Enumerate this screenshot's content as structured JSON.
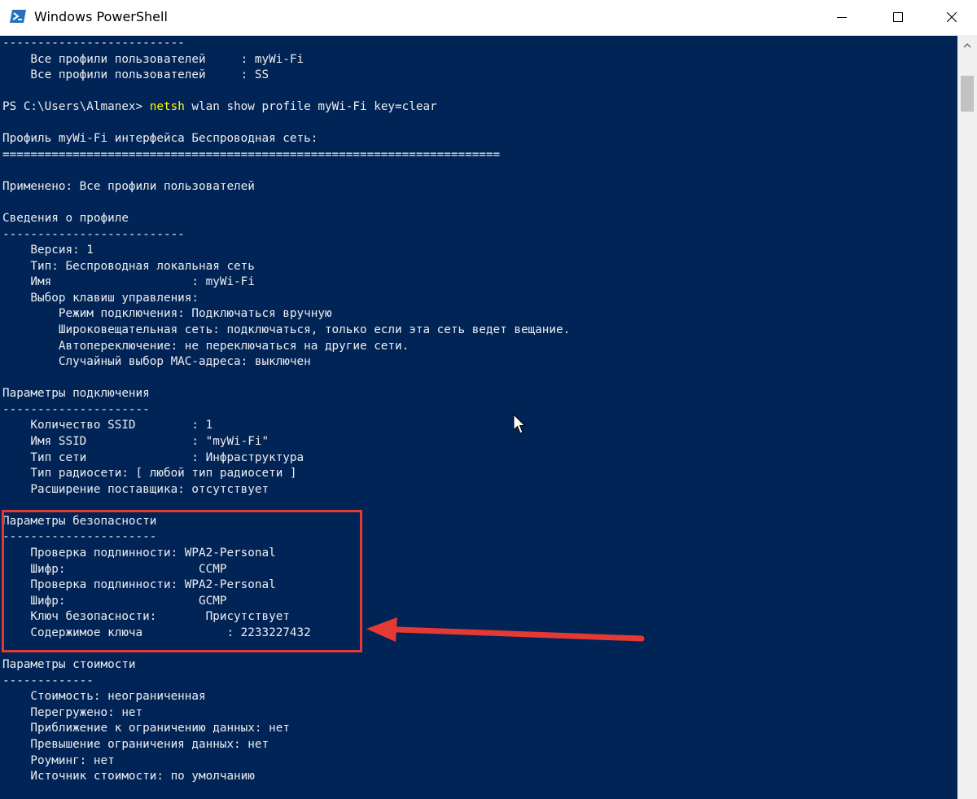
{
  "window": {
    "title": "Windows PowerShell",
    "icon": "powershell-icon",
    "controls": [
      "minimize-icon",
      "maximize-icon",
      "close-icon"
    ]
  },
  "terminal": {
    "lines": [
      "--------------------------",
      "    Все профили пользователей     : myWi-Fi",
      "    Все профили пользователей     : SS",
      "",
      "",
      "Профиль myWi-Fi интерфейса Беспроводная сеть:",
      "=======================================================================",
      "",
      "Применено: Все профили пользователей",
      "",
      "Сведения о профиле",
      "--------------------------",
      "    Версия: 1",
      "    Тип: Беспроводная локальная сеть",
      "    Имя                    : myWi-Fi",
      "    Выбор клавиш управления:",
      "        Режим подключения: Подключаться вручную",
      "        Широковещательная сеть: подключаться, только если эта сеть ведет вещание.",
      "        Автопереключение: не переключаться на другие сети.",
      "        Случайный выбор MAC-адреса: выключен",
      "",
      "Параметры подключения",
      "---------------------",
      "    Количество SSID        : 1",
      "    Имя SSID               : \"myWi-Fi\"",
      "    Тип сети               : Инфраструктура",
      "    Тип радиосети: [ любой тип радиосети ]",
      "    Расширение поставщика: отсутствует",
      "",
      "Параметры безопасности",
      "----------------------",
      "    Проверка подлинности: WPA2-Personal",
      "    Шифр:                   CCMP",
      "    Проверка подлинности: WPA2-Personal",
      "    Шифр:                   GCMP",
      "    Ключ безопасности:       Присутствует",
      "    Содержимое ключа            : 2233227432",
      "",
      "Параметры стоимости",
      "-------------",
      "    Стоимость: неограниченная",
      "    Перегружено: нет",
      "    Приближение к ограничению данных: нет",
      "    Превышение ограничения данных: нет",
      "    Роуминг: нет",
      "    Источник стоимости: по умолчанию"
    ],
    "prompt": "PS C:\\Users\\Almanex> ",
    "command_exe": "netsh",
    "command_args": " wlan show profile myWi-Fi key=clear"
  },
  "colors": {
    "background": "#012456",
    "text": "#eeedf0",
    "command": "#ffff00",
    "annotation": "#e53935"
  }
}
